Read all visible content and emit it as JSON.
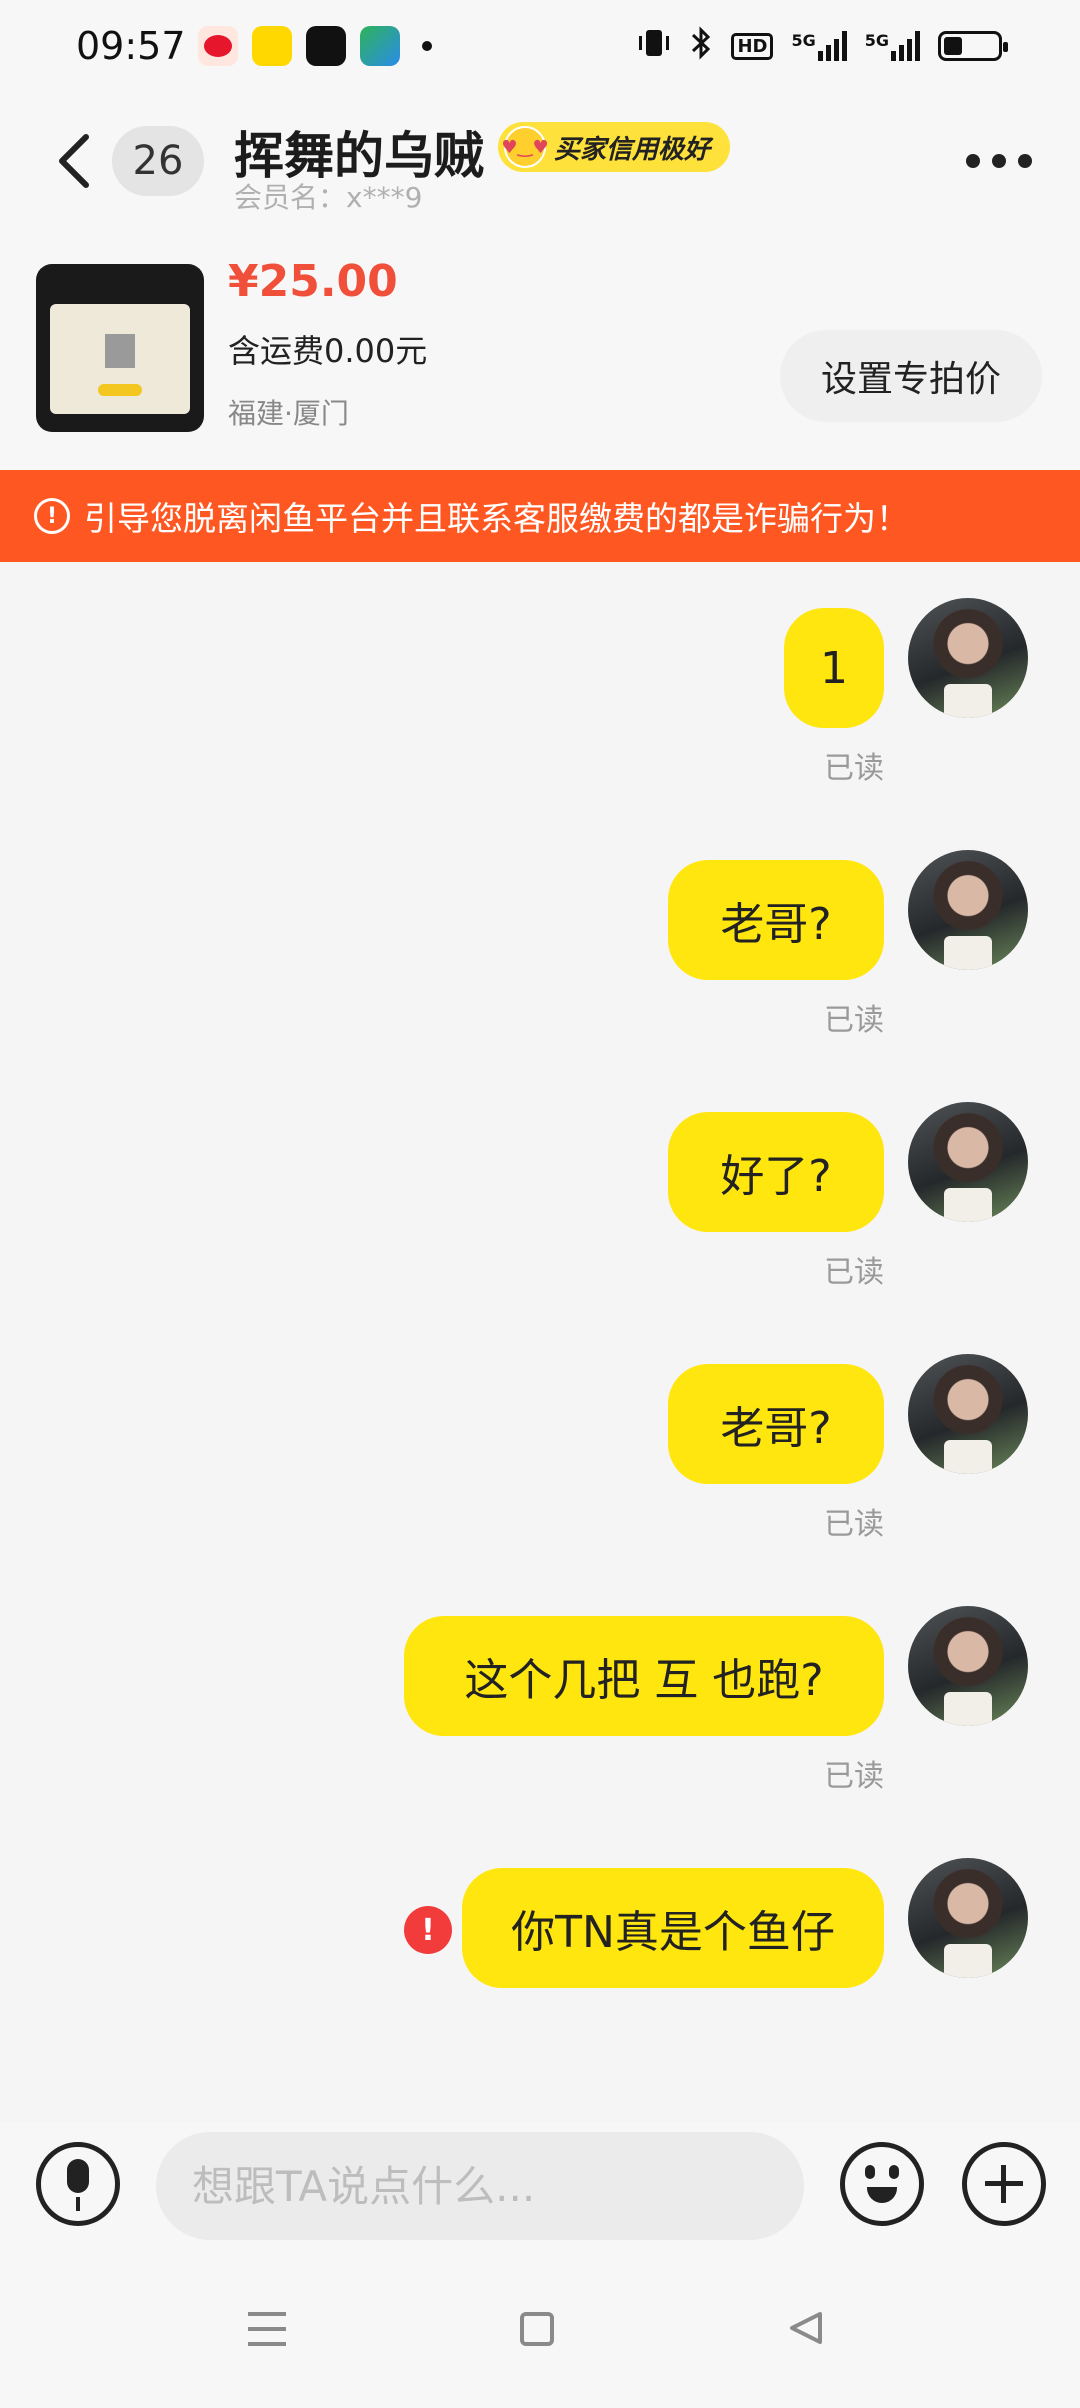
{
  "status_bar": {
    "time": "09:57",
    "apps": [
      "weibo-icon",
      "yellow-app-icon",
      "dark-app-icon",
      "green-app-icon"
    ],
    "network": "5G",
    "hd_label": "HD"
  },
  "header": {
    "unread_count": "26",
    "nickname": "挥舞的乌贼",
    "credit_badge": "买家信用极好",
    "member_label": "会员名：x***9"
  },
  "product": {
    "price": "¥25.00",
    "shipping": "含运费0.00元",
    "location": "福建·厦门",
    "special_price_button": "设置专拍价"
  },
  "warning": {
    "text": "引导您脱离闲鱼平台并且联系客服缴费的都是诈骗行为！"
  },
  "messages": [
    {
      "text": "1",
      "status": "已读"
    },
    {
      "text": "老哥?",
      "status": "已读"
    },
    {
      "text": "好了?",
      "status": "已读"
    },
    {
      "text": "老哥?",
      "status": "已读"
    },
    {
      "text": "这个几把 互 也跑?",
      "status": "已读"
    },
    {
      "text": "你TN真是个鱼仔",
      "status": "",
      "failed": true
    }
  ],
  "input_bar": {
    "placeholder": "想跟TA说点什么..."
  },
  "colors": {
    "bubble": "#ffe60f",
    "warning_bg": "#ff5722",
    "price": "#f0503a",
    "credit_badge": "#ffe13c",
    "error": "#f23c3c"
  }
}
